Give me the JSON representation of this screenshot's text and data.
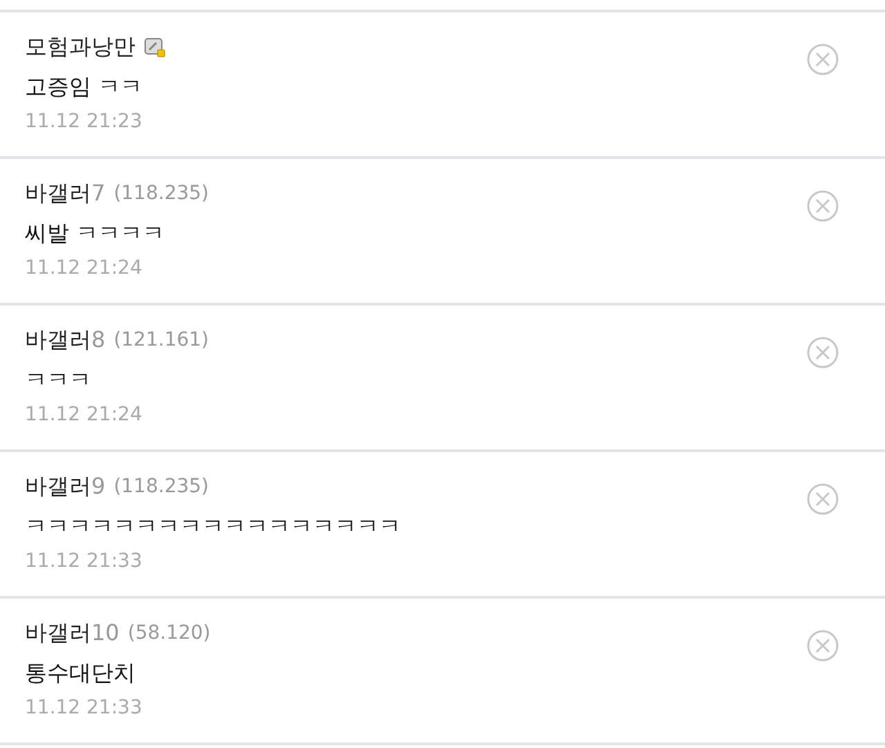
{
  "comments": [
    {
      "author": "모험과낭만",
      "badge": true,
      "text": "고증임 ㅋㅋ",
      "time": "11.12 21:23"
    },
    {
      "author": "바갤러",
      "author_suffix": "7",
      "ip": "(118.235)",
      "badge": false,
      "text": "씨발 ㅋㅋㅋㅋ",
      "time": "11.12 21:24"
    },
    {
      "author": "바갤러",
      "author_suffix": "8",
      "ip": "(121.161)",
      "badge": false,
      "text": "ㅋㅋㅋ",
      "time": "11.12 21:24"
    },
    {
      "author": "바갤러",
      "author_suffix": "9",
      "ip": "(118.235)",
      "badge": false,
      "text": "ㅋㅋㅋㅋㅋㅋㅋㅋㅋㅋㅋㅋㅋㅋㅋㅋㅋ",
      "time": "11.12 21:33"
    },
    {
      "author": "바갤러",
      "author_suffix": "10",
      "ip": "(58.120)",
      "badge": false,
      "text": "통수대단치",
      "time": "11.12 21:33"
    }
  ]
}
